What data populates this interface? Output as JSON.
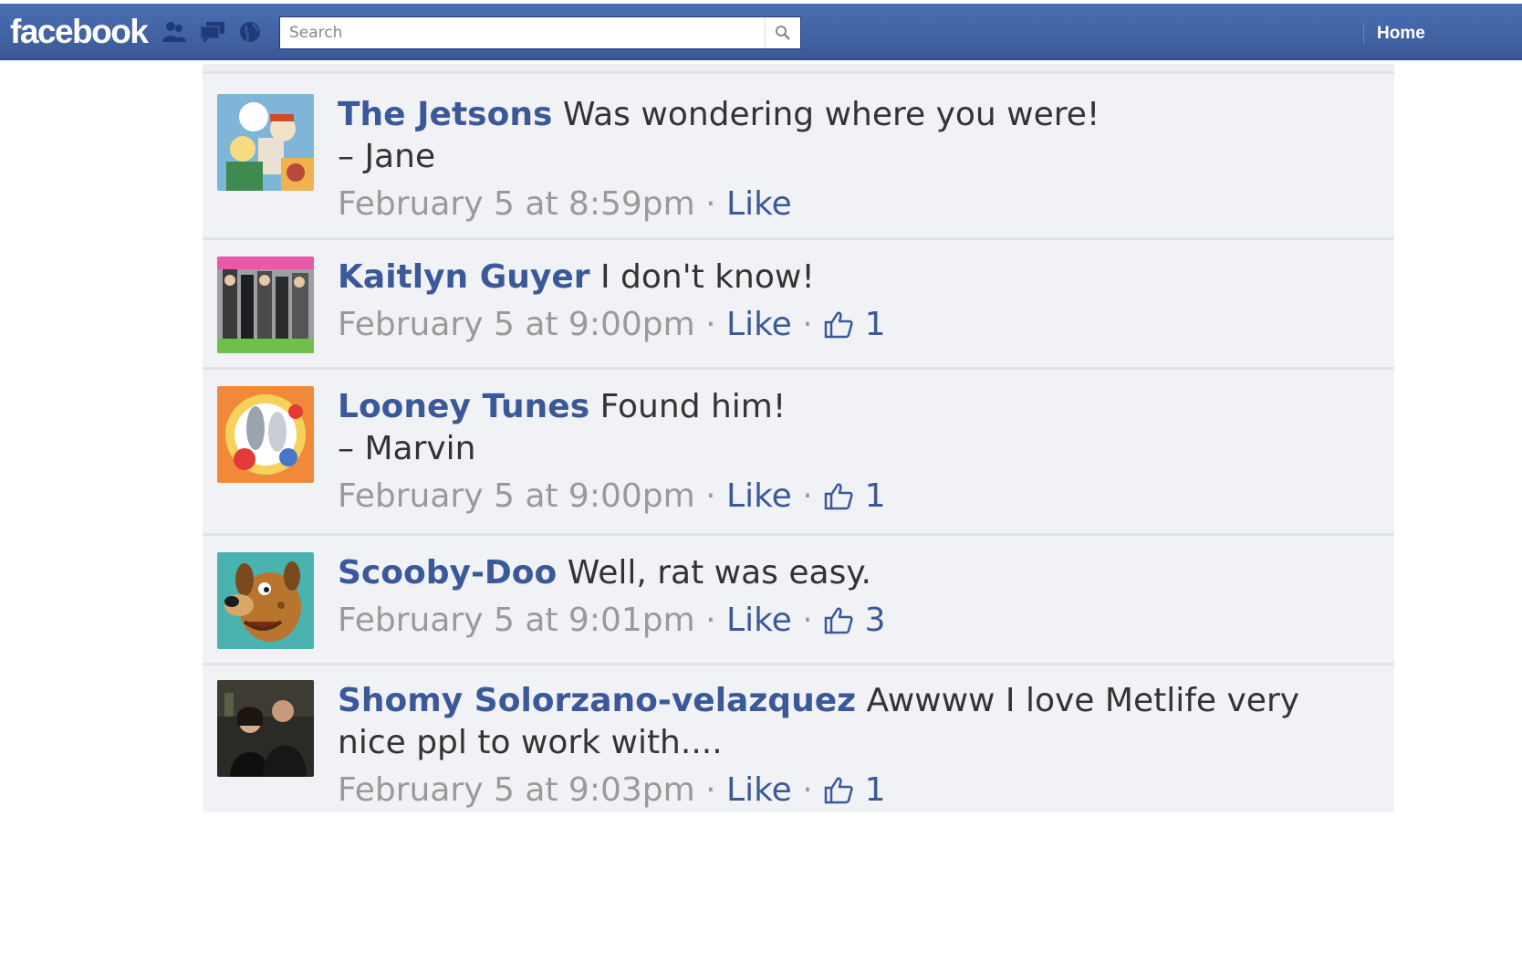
{
  "header": {
    "logo": "facebook",
    "search_placeholder": "Search",
    "home_label": "Home",
    "colors": {
      "bar": "#3b5998",
      "link": "#3b5998"
    }
  },
  "comments": [
    {
      "author": "The Jetsons",
      "text": "Was wondering where you were!",
      "signature": "– Jane",
      "time": "February 5 at 8:59pm",
      "like_label": "Like",
      "like_count": ""
    },
    {
      "author": "Kaitlyn Guyer",
      "text": "I don't know!",
      "signature": "",
      "time": "February 5 at 9:00pm",
      "like_label": "Like",
      "like_count": "1"
    },
    {
      "author": "Looney Tunes",
      "text": "Found him!",
      "signature": "– Marvin",
      "time": "February 5 at 9:00pm",
      "like_label": "Like",
      "like_count": "1"
    },
    {
      "author": "Scooby-Doo",
      "text": "Well, rat was easy.",
      "signature": "",
      "time": "February 5 at 9:01pm",
      "like_label": "Like",
      "like_count": "3"
    },
    {
      "author": "Shomy Solorzano-velazquez",
      "text": "Awwww I love Metlife very nice ppl to work with....",
      "signature": "",
      "time": "February 5 at 9:03pm",
      "like_label": "Like",
      "like_count": "1"
    }
  ]
}
